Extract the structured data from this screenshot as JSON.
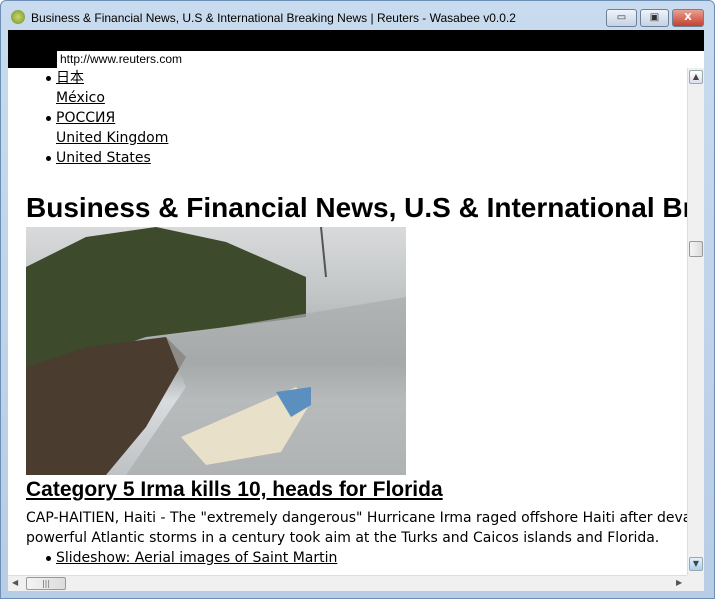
{
  "window": {
    "title": "Business & Financial News, U.S & International Breaking News  | Reuters - Wasabee v0.0.2",
    "icon": "wasabee-app-icon",
    "minimize": "▭",
    "maximize": "▣",
    "close": "X"
  },
  "address_bar": {
    "value": "http://www.reuters.com"
  },
  "editions": [
    {
      "label": "日本",
      "bullet": true
    },
    {
      "label": "México",
      "bullet": false
    },
    {
      "label": "РОССИЯ",
      "bullet": true
    },
    {
      "label": "United Kingdom",
      "bullet": false
    },
    {
      "label": "United States",
      "bullet": true
    }
  ],
  "page": {
    "heading": "Business & Financial News, U.S & International Breaking News",
    "story": {
      "image": "hurricane-boat-photo",
      "headline": "Category 5 Irma kills 10, heads for Florida",
      "summary_line1": "CAP-HAITIEN, Haiti - The \"extremely dangerous\" Hurricane Irma raged offshore Haiti after devastating",
      "summary_line2": "powerful Atlantic storms in a century took aim at the Turks and Caicos islands and Florida.",
      "related": [
        {
          "label": "Slideshow: Aerial images of Saint Martin"
        }
      ]
    }
  }
}
